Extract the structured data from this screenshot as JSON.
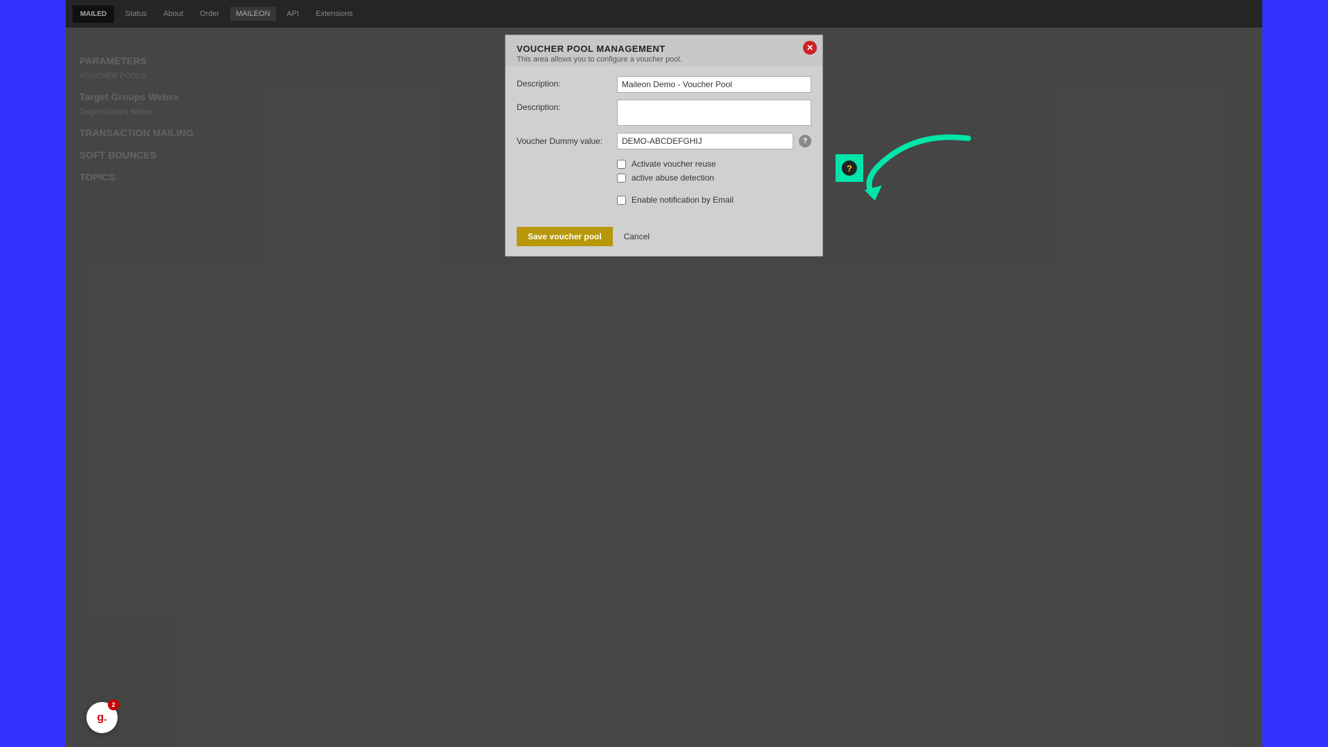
{
  "colors": {
    "blue_sidebar": "#3333ff",
    "bg_main": "#6b6b6b",
    "modal_bg": "#d0d0d0",
    "close_btn": "#cc2222",
    "save_btn": "#b8970a",
    "highlight": "#00e5aa"
  },
  "topbar": {
    "logo": "MAILED",
    "nav_items": [
      "Status",
      "About",
      "Order",
      "MAILEON",
      "API",
      "Extensions"
    ]
  },
  "bg_content": {
    "sections": [
      {
        "title": "PARAMETERS",
        "label1": "VOUCHER POOLS",
        "rows": [
          {
            "label": "Target Groups Webex",
            "value": ""
          },
          {
            "label": "Target Groups Webex",
            "value": ""
          }
        ]
      },
      {
        "title": "TRANSACTION MAILING",
        "rows": [
          {
            "label": "",
            "value": ""
          }
        ]
      },
      {
        "title": "SOFT BOUNCES",
        "rows": []
      },
      {
        "title": "TOPICS",
        "rows": []
      }
    ]
  },
  "modal": {
    "title": "VOUCHER POOL MANAGEMENT",
    "subtitle": "This area allows you to configure a voucher pool.",
    "fields": {
      "description1_label": "Description:",
      "description1_value": "Maileon Demo - Voucher Pool",
      "description2_label": "Description:",
      "description2_value": "",
      "voucher_dummy_label": "Voucher Dummy value:",
      "voucher_dummy_value": "DEMO-ABCDEFGHIJ"
    },
    "checkboxes": {
      "voucher_reuse_label": "Activate voucher reuse",
      "voucher_reuse_checked": false,
      "abuse_detection_label": "active abuse detection",
      "abuse_detection_checked": false,
      "email_notification_label": "Enable notification by Email",
      "email_notification_checked": false
    },
    "buttons": {
      "save_label": "Save voucher pool",
      "cancel_label": "Cancel"
    },
    "help_tooltip": "?"
  },
  "highlight": {
    "icon": "?"
  },
  "grammarly": {
    "letter": "g.",
    "count": "2"
  }
}
